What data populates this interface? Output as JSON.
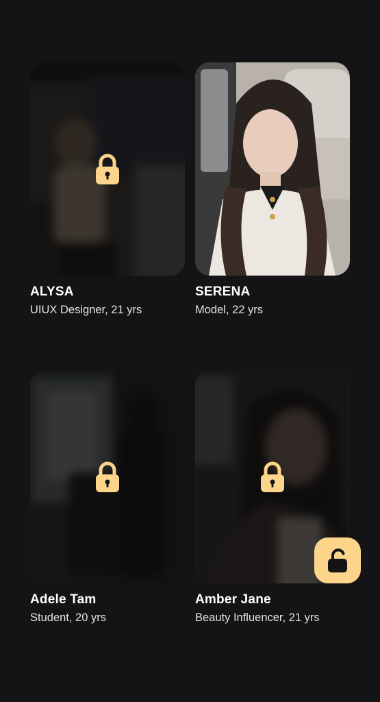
{
  "profiles": [
    {
      "name": "ALYSA",
      "subtitle": "UIUX Designer, 21 yrs",
      "locked": true
    },
    {
      "name": "SERENA",
      "subtitle": "Model, 22 yrs",
      "locked": false
    },
    {
      "name": "Adele Tam",
      "subtitle": "Student, 20 yrs",
      "locked": true
    },
    {
      "name": "Amber Jane",
      "subtitle": "Beauty Influencer, 21 yrs",
      "locked": true
    }
  ],
  "icons": {
    "lock": "lock-icon",
    "unlock_button": "unlock-icon"
  },
  "colors": {
    "background": "#141416",
    "accent": "#fcd48a",
    "lock_body": "#fcd48a"
  }
}
